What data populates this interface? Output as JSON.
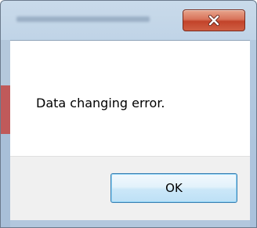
{
  "window": {
    "title": "",
    "message": "Data changing error.",
    "close_icon": "close-icon"
  },
  "buttons": {
    "ok_label": "OK"
  },
  "colors": {
    "close_button": "#c9503a",
    "ok_border": "#3c7fb1",
    "footer_bg": "#f0f0f0",
    "content_bg": "#ffffff"
  }
}
